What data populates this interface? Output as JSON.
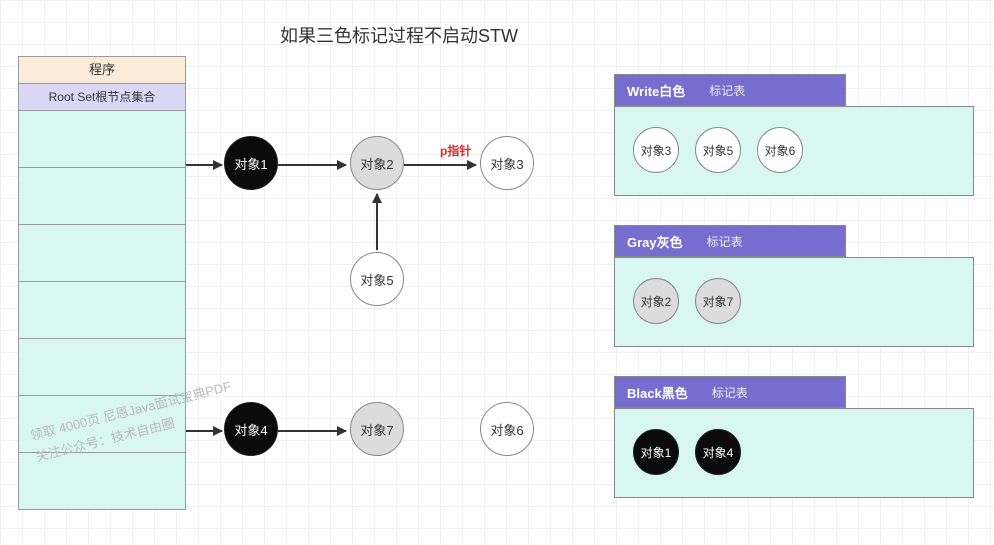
{
  "title": "如果三色标记过程不启动STW",
  "program_header": "程序",
  "rootset_header": "Root Set根节点集合",
  "rootset_rows": 7,
  "pointer_label": "p指针",
  "nodes": {
    "obj1": "对象1",
    "obj2": "对象2",
    "obj3": "对象3",
    "obj4": "对象4",
    "obj5": "对象5",
    "obj6": "对象6",
    "obj7": "对象7"
  },
  "panels": {
    "white": {
      "main": "Write白色",
      "sub": "标记表",
      "items": [
        "对象3",
        "对象5",
        "对象6"
      ]
    },
    "gray": {
      "main": "Gray灰色",
      "sub": "标记表",
      "items": [
        "对象2",
        "对象7"
      ]
    },
    "black": {
      "main": "Black黑色",
      "sub": "标记表",
      "items": [
        "对象1",
        "对象4"
      ]
    }
  },
  "watermark_line1": "领取 4000页 尼恩Java面试宝典PDF",
  "watermark_line2": "关注公众号：技术自由圈"
}
